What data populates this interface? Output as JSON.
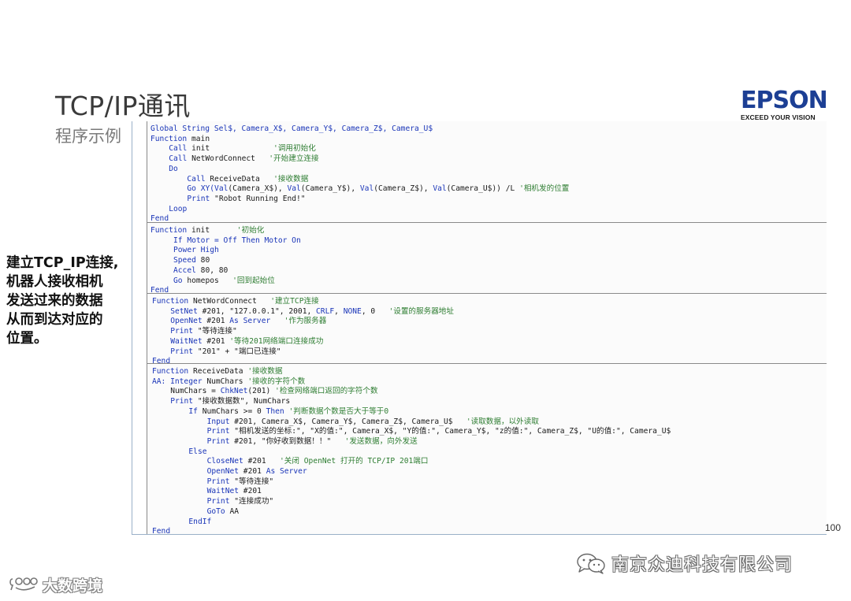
{
  "slide": {
    "title": "TCP/IP通讯",
    "subtitle": "程序示例",
    "page_number": "100"
  },
  "logo": {
    "word": "EPSON",
    "tagline": "EXCEED YOUR VISION"
  },
  "side_note": {
    "lines": [
      "建立TCP_IP连接,",
      "机器人接收相机",
      "发送过来的数据",
      "从而到达对应的",
      "位置。"
    ]
  },
  "code_blocks": [
    {
      "lines": [
        {
          "indent": 0,
          "parts": [
            {
              "t": "Global String Sel$, Camera_X$, Camera_Y$, Camera_Z$, Camera_U$",
              "c": "kw"
            }
          ]
        },
        {
          "indent": 0,
          "parts": [
            {
              "t": "Function",
              "c": "kw"
            },
            {
              "t": " main",
              "c": ""
            }
          ]
        },
        {
          "indent": 4,
          "parts": [
            {
              "t": "Call",
              "c": "kw"
            },
            {
              "t": " init              ",
              "c": ""
            },
            {
              "t": "'调用初始化",
              "c": "cm"
            }
          ]
        },
        {
          "indent": 4,
          "parts": [
            {
              "t": "Call",
              "c": "kw"
            },
            {
              "t": " NetWordConnect   ",
              "c": ""
            },
            {
              "t": "'开始建立连接",
              "c": "cm"
            }
          ]
        },
        {
          "indent": 4,
          "parts": [
            {
              "t": "Do",
              "c": "kw"
            }
          ]
        },
        {
          "indent": 8,
          "parts": [
            {
              "t": "Call",
              "c": "kw"
            },
            {
              "t": " ReceiveData   ",
              "c": ""
            },
            {
              "t": "'接收数据",
              "c": "cm"
            }
          ]
        },
        {
          "indent": 8,
          "parts": [
            {
              "t": "Go XY(Val",
              "c": "kw"
            },
            {
              "t": "(Camera_X$), ",
              "c": ""
            },
            {
              "t": "Val",
              "c": "kw"
            },
            {
              "t": "(Camera_Y$), ",
              "c": ""
            },
            {
              "t": "Val",
              "c": "kw"
            },
            {
              "t": "(Camera_Z$), ",
              "c": ""
            },
            {
              "t": "Val",
              "c": "kw"
            },
            {
              "t": "(Camera_U$)) /L ",
              "c": ""
            },
            {
              "t": "'相机发的位置",
              "c": "cm"
            }
          ]
        },
        {
          "indent": 8,
          "parts": [
            {
              "t": "Print",
              "c": "kw"
            },
            {
              "t": " \"Robot Running End!\"",
              "c": ""
            }
          ]
        },
        {
          "indent": 4,
          "parts": [
            {
              "t": "Loop",
              "c": "kw"
            }
          ]
        },
        {
          "indent": 0,
          "parts": [
            {
              "t": "Fend",
              "c": "kw"
            }
          ]
        }
      ]
    },
    {
      "lines": [
        {
          "indent": 0,
          "parts": [
            {
              "t": "Function",
              "c": "kw"
            },
            {
              "t": " init      ",
              "c": ""
            },
            {
              "t": "'初始化",
              "c": "cm"
            }
          ]
        },
        {
          "indent": 5,
          "parts": [
            {
              "t": "If Motor = Off Then Motor On",
              "c": "kw"
            }
          ]
        },
        {
          "indent": 5,
          "parts": [
            {
              "t": "Power High",
              "c": "kw"
            }
          ]
        },
        {
          "indent": 5,
          "parts": [
            {
              "t": "Speed",
              "c": "kw"
            },
            {
              "t": " 80",
              "c": ""
            }
          ]
        },
        {
          "indent": 5,
          "parts": [
            {
              "t": "Accel",
              "c": "kw"
            },
            {
              "t": " 80, 80",
              "c": ""
            }
          ]
        },
        {
          "indent": 5,
          "parts": [
            {
              "t": "Go",
              "c": "kw"
            },
            {
              "t": " homepos   ",
              "c": ""
            },
            {
              "t": "'回到起始位",
              "c": "cm"
            }
          ]
        },
        {
          "indent": 0,
          "parts": [
            {
              "t": "Fend",
              "c": "kw"
            }
          ]
        }
      ]
    },
    {
      "lines": [
        {
          "indent": 0,
          "parts": [
            {
              "t": "Function",
              "c": "kw"
            },
            {
              "t": " NetWordConnect   ",
              "c": ""
            },
            {
              "t": "'建立TCP连接",
              "c": "cm"
            }
          ]
        },
        {
          "indent": 4,
          "parts": [
            {
              "t": "SetNet",
              "c": "kw"
            },
            {
              "t": " #201, \"127.0.0.1\", 2001, ",
              "c": ""
            },
            {
              "t": "CRLF",
              "c": "kw"
            },
            {
              "t": ", ",
              "c": ""
            },
            {
              "t": "NONE",
              "c": "kw"
            },
            {
              "t": ", 0   ",
              "c": ""
            },
            {
              "t": "'设置的服务器地址",
              "c": "cm"
            }
          ]
        },
        {
          "indent": 4,
          "parts": [
            {
              "t": "OpenNet",
              "c": "kw"
            },
            {
              "t": " #201 ",
              "c": ""
            },
            {
              "t": "As Server",
              "c": "kw"
            },
            {
              "t": "   ",
              "c": ""
            },
            {
              "t": "'作为服务器",
              "c": "cm"
            }
          ]
        },
        {
          "indent": 4,
          "parts": [
            {
              "t": "Print",
              "c": "kw"
            },
            {
              "t": " \"等待连接\"",
              "c": ""
            }
          ]
        },
        {
          "indent": 4,
          "parts": [
            {
              "t": "WaitNet",
              "c": "kw"
            },
            {
              "t": " #201 ",
              "c": ""
            },
            {
              "t": "'等待201网络端口连接成功",
              "c": "cm"
            }
          ]
        },
        {
          "indent": 4,
          "parts": [
            {
              "t": "Print",
              "c": "kw"
            },
            {
              "t": " \"201\" + \"端口已连接\"",
              "c": ""
            }
          ]
        },
        {
          "indent": 0,
          "parts": [
            {
              "t": "Fend",
              "c": "kw"
            }
          ]
        }
      ]
    },
    {
      "lines": [
        {
          "indent": 0,
          "parts": [
            {
              "t": "Function",
              "c": "kw"
            },
            {
              "t": " ReceiveData ",
              "c": ""
            },
            {
              "t": "'接收数据",
              "c": "cm"
            }
          ]
        },
        {
          "indent": 0,
          "parts": [
            {
              "t": "AA: Integer",
              "c": "kw"
            },
            {
              "t": " NumChars ",
              "c": ""
            },
            {
              "t": "'接收的字符个数",
              "c": "cm"
            }
          ]
        },
        {
          "indent": 4,
          "parts": [
            {
              "t": "NumChars = ",
              "c": ""
            },
            {
              "t": "ChkNet",
              "c": "kw"
            },
            {
              "t": "(201) ",
              "c": ""
            },
            {
              "t": "'检查网络端口返回的字符个数",
              "c": "cm"
            }
          ]
        },
        {
          "indent": 4,
          "parts": [
            {
              "t": "Print",
              "c": "kw"
            },
            {
              "t": " \"接收数据数\", NumChars",
              "c": ""
            }
          ]
        },
        {
          "indent": 8,
          "parts": [
            {
              "t": "If",
              "c": "kw"
            },
            {
              "t": " NumChars >= 0 ",
              "c": ""
            },
            {
              "t": "Then",
              "c": "kw"
            },
            {
              "t": " ",
              "c": ""
            },
            {
              "t": "'判断数据个数是否大于等于0",
              "c": "cm"
            }
          ]
        },
        {
          "indent": 12,
          "parts": [
            {
              "t": "Input",
              "c": "kw"
            },
            {
              "t": " #201, Camera_X$, Camera_Y$, Camera_Z$, Camera_U$   ",
              "c": ""
            },
            {
              "t": "'读取数据，以外读取",
              "c": "cm"
            }
          ]
        },
        {
          "indent": 12,
          "parts": [
            {
              "t": "Print",
              "c": "kw"
            },
            {
              "t": " \"相机发送的坐标:\", \"X的值:\", Camera_X$, \"Y的值:\", Camera_Y$, \"z的值:\", Camera_Z$, \"U的值:\", Camera_U$",
              "c": ""
            }
          ]
        },
        {
          "indent": 12,
          "parts": [
            {
              "t": "Print",
              "c": "kw"
            },
            {
              "t": " #201, \"你好收到数据！！\"   ",
              "c": ""
            },
            {
              "t": "'发送数据，向外发送",
              "c": "cm"
            }
          ]
        },
        {
          "indent": 8,
          "parts": [
            {
              "t": "Else",
              "c": "kw"
            }
          ]
        },
        {
          "indent": 12,
          "parts": [
            {
              "t": "CloseNet",
              "c": "kw"
            },
            {
              "t": " #201   ",
              "c": ""
            },
            {
              "t": "'关闭 OpenNet 打开的 TCP/IP 201端口",
              "c": "cm"
            }
          ]
        },
        {
          "indent": 12,
          "parts": [
            {
              "t": "OpenNet",
              "c": "kw"
            },
            {
              "t": " #201 ",
              "c": ""
            },
            {
              "t": "As Server",
              "c": "kw"
            }
          ]
        },
        {
          "indent": 12,
          "parts": [
            {
              "t": "Print",
              "c": "kw"
            },
            {
              "t": " \"等待连接\"",
              "c": ""
            }
          ]
        },
        {
          "indent": 12,
          "parts": [
            {
              "t": "WaitNet",
              "c": "kw"
            },
            {
              "t": " #201",
              "c": ""
            }
          ]
        },
        {
          "indent": 12,
          "parts": [
            {
              "t": "Print",
              "c": "kw"
            },
            {
              "t": " \"连接成功\"",
              "c": ""
            }
          ]
        },
        {
          "indent": 12,
          "parts": [
            {
              "t": "GoTo",
              "c": "kw"
            },
            {
              "t": " AA",
              "c": ""
            }
          ]
        },
        {
          "indent": 8,
          "parts": [
            {
              "t": "EndIf",
              "c": "kw"
            }
          ]
        },
        {
          "indent": 0,
          "parts": [
            {
              "t": "Fend",
              "c": "kw"
            }
          ]
        }
      ]
    }
  ],
  "wechat_mark": {
    "icon": "wechat-icon",
    "text": "南京众迪科技有限公司"
  },
  "watermark": {
    "icon": "dashu-logo-icon",
    "text": "大数跨境"
  },
  "colors": {
    "keyword": "#1a35b8",
    "comment": "#2e7d32",
    "brand_blue": "#1c3f94"
  }
}
